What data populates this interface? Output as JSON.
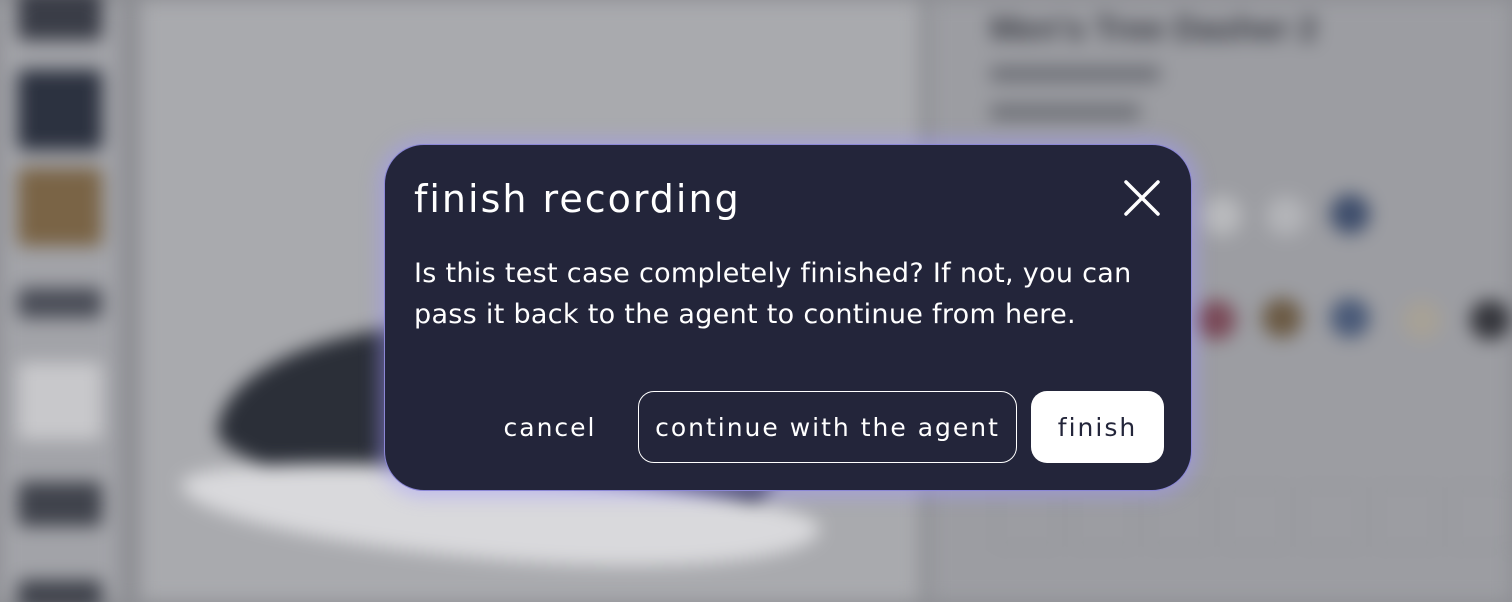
{
  "modal": {
    "title": "finish recording",
    "body": "Is this test case completely finished? If not, you can pass it back to the agent to continue from here.",
    "buttons": {
      "cancel": "cancel",
      "continue": "continue with the agent",
      "finish": "finish"
    },
    "icons": {
      "close": "close-icon"
    }
  },
  "background": {
    "product_title": "Men's Tree Dasher 2"
  },
  "colors": {
    "modal_bg": "#23253a",
    "modal_border": "#8b87d6",
    "button_text_dark": "#23253a",
    "overlay": "#8d8e93"
  }
}
